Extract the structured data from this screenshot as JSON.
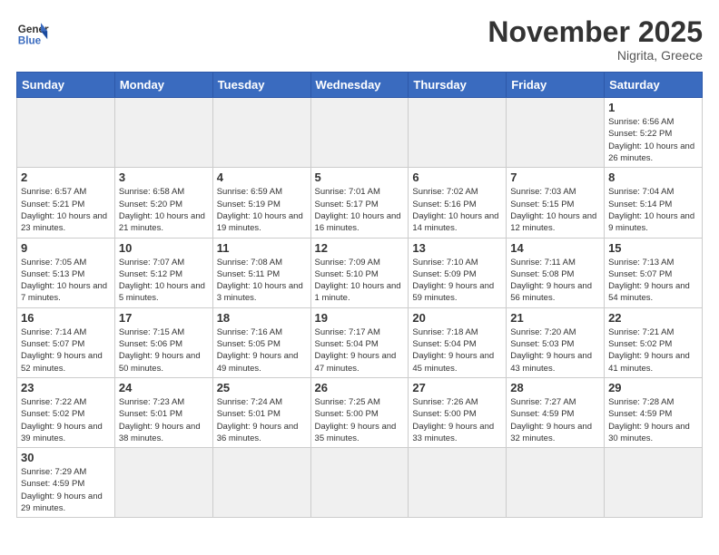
{
  "header": {
    "logo_general": "General",
    "logo_blue": "Blue",
    "month_title": "November 2025",
    "location": "Nigrita, Greece"
  },
  "weekdays": [
    "Sunday",
    "Monday",
    "Tuesday",
    "Wednesday",
    "Thursday",
    "Friday",
    "Saturday"
  ],
  "weeks": [
    [
      {
        "day": "",
        "info": ""
      },
      {
        "day": "",
        "info": ""
      },
      {
        "day": "",
        "info": ""
      },
      {
        "day": "",
        "info": ""
      },
      {
        "day": "",
        "info": ""
      },
      {
        "day": "",
        "info": ""
      },
      {
        "day": "1",
        "info": "Sunrise: 6:56 AM\nSunset: 5:22 PM\nDaylight: 10 hours and 26 minutes."
      }
    ],
    [
      {
        "day": "2",
        "info": "Sunrise: 6:57 AM\nSunset: 5:21 PM\nDaylight: 10 hours and 23 minutes."
      },
      {
        "day": "3",
        "info": "Sunrise: 6:58 AM\nSunset: 5:20 PM\nDaylight: 10 hours and 21 minutes."
      },
      {
        "day": "4",
        "info": "Sunrise: 6:59 AM\nSunset: 5:19 PM\nDaylight: 10 hours and 19 minutes."
      },
      {
        "day": "5",
        "info": "Sunrise: 7:01 AM\nSunset: 5:17 PM\nDaylight: 10 hours and 16 minutes."
      },
      {
        "day": "6",
        "info": "Sunrise: 7:02 AM\nSunset: 5:16 PM\nDaylight: 10 hours and 14 minutes."
      },
      {
        "day": "7",
        "info": "Sunrise: 7:03 AM\nSunset: 5:15 PM\nDaylight: 10 hours and 12 minutes."
      },
      {
        "day": "8",
        "info": "Sunrise: 7:04 AM\nSunset: 5:14 PM\nDaylight: 10 hours and 9 minutes."
      }
    ],
    [
      {
        "day": "9",
        "info": "Sunrise: 7:05 AM\nSunset: 5:13 PM\nDaylight: 10 hours and 7 minutes."
      },
      {
        "day": "10",
        "info": "Sunrise: 7:07 AM\nSunset: 5:12 PM\nDaylight: 10 hours and 5 minutes."
      },
      {
        "day": "11",
        "info": "Sunrise: 7:08 AM\nSunset: 5:11 PM\nDaylight: 10 hours and 3 minutes."
      },
      {
        "day": "12",
        "info": "Sunrise: 7:09 AM\nSunset: 5:10 PM\nDaylight: 10 hours and 1 minute."
      },
      {
        "day": "13",
        "info": "Sunrise: 7:10 AM\nSunset: 5:09 PM\nDaylight: 9 hours and 59 minutes."
      },
      {
        "day": "14",
        "info": "Sunrise: 7:11 AM\nSunset: 5:08 PM\nDaylight: 9 hours and 56 minutes."
      },
      {
        "day": "15",
        "info": "Sunrise: 7:13 AM\nSunset: 5:07 PM\nDaylight: 9 hours and 54 minutes."
      }
    ],
    [
      {
        "day": "16",
        "info": "Sunrise: 7:14 AM\nSunset: 5:07 PM\nDaylight: 9 hours and 52 minutes."
      },
      {
        "day": "17",
        "info": "Sunrise: 7:15 AM\nSunset: 5:06 PM\nDaylight: 9 hours and 50 minutes."
      },
      {
        "day": "18",
        "info": "Sunrise: 7:16 AM\nSunset: 5:05 PM\nDaylight: 9 hours and 49 minutes."
      },
      {
        "day": "19",
        "info": "Sunrise: 7:17 AM\nSunset: 5:04 PM\nDaylight: 9 hours and 47 minutes."
      },
      {
        "day": "20",
        "info": "Sunrise: 7:18 AM\nSunset: 5:04 PM\nDaylight: 9 hours and 45 minutes."
      },
      {
        "day": "21",
        "info": "Sunrise: 7:20 AM\nSunset: 5:03 PM\nDaylight: 9 hours and 43 minutes."
      },
      {
        "day": "22",
        "info": "Sunrise: 7:21 AM\nSunset: 5:02 PM\nDaylight: 9 hours and 41 minutes."
      }
    ],
    [
      {
        "day": "23",
        "info": "Sunrise: 7:22 AM\nSunset: 5:02 PM\nDaylight: 9 hours and 39 minutes."
      },
      {
        "day": "24",
        "info": "Sunrise: 7:23 AM\nSunset: 5:01 PM\nDaylight: 9 hours and 38 minutes."
      },
      {
        "day": "25",
        "info": "Sunrise: 7:24 AM\nSunset: 5:01 PM\nDaylight: 9 hours and 36 minutes."
      },
      {
        "day": "26",
        "info": "Sunrise: 7:25 AM\nSunset: 5:00 PM\nDaylight: 9 hours and 35 minutes."
      },
      {
        "day": "27",
        "info": "Sunrise: 7:26 AM\nSunset: 5:00 PM\nDaylight: 9 hours and 33 minutes."
      },
      {
        "day": "28",
        "info": "Sunrise: 7:27 AM\nSunset: 4:59 PM\nDaylight: 9 hours and 32 minutes."
      },
      {
        "day": "29",
        "info": "Sunrise: 7:28 AM\nSunset: 4:59 PM\nDaylight: 9 hours and 30 minutes."
      }
    ],
    [
      {
        "day": "30",
        "info": "Sunrise: 7:29 AM\nSunset: 4:59 PM\nDaylight: 9 hours and 29 minutes."
      },
      {
        "day": "",
        "info": ""
      },
      {
        "day": "",
        "info": ""
      },
      {
        "day": "",
        "info": ""
      },
      {
        "day": "",
        "info": ""
      },
      {
        "day": "",
        "info": ""
      },
      {
        "day": "",
        "info": ""
      }
    ]
  ]
}
